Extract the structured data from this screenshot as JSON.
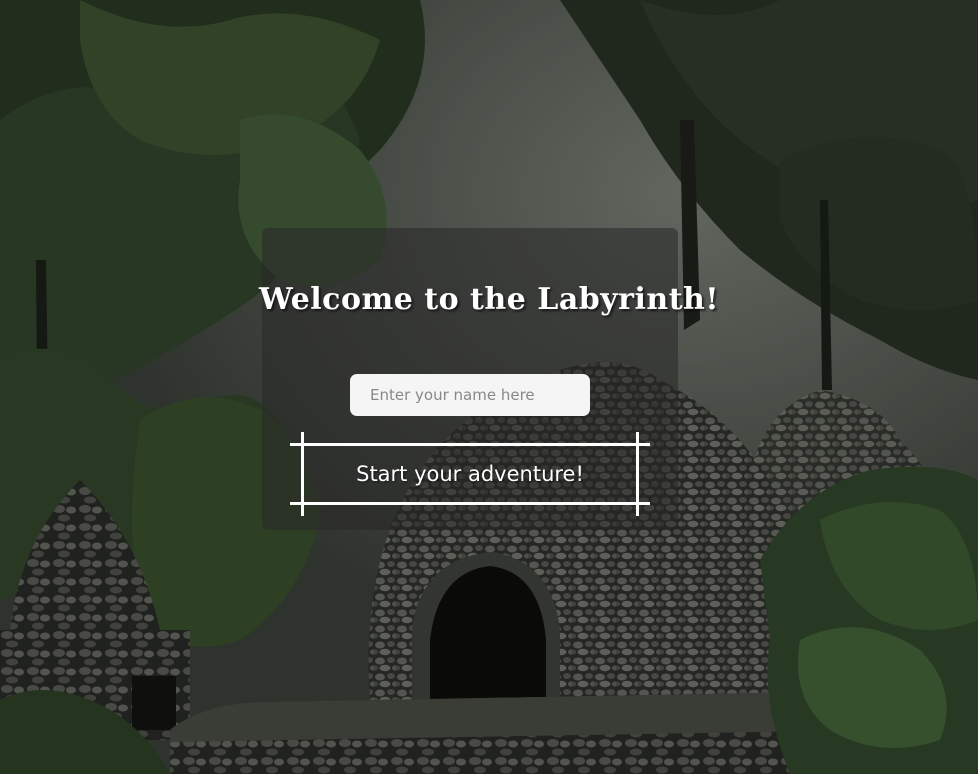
{
  "page": {
    "title": "Welcome to the Labyrinth!"
  },
  "form": {
    "name_placeholder": "Enter your name here",
    "name_value": "",
    "start_label": "Start your adventure!"
  },
  "theme": {
    "text_color": "#ffffff",
    "input_bg": "#f5f5f5",
    "panel_overlay": "rgba(40,40,40,0.55)"
  }
}
